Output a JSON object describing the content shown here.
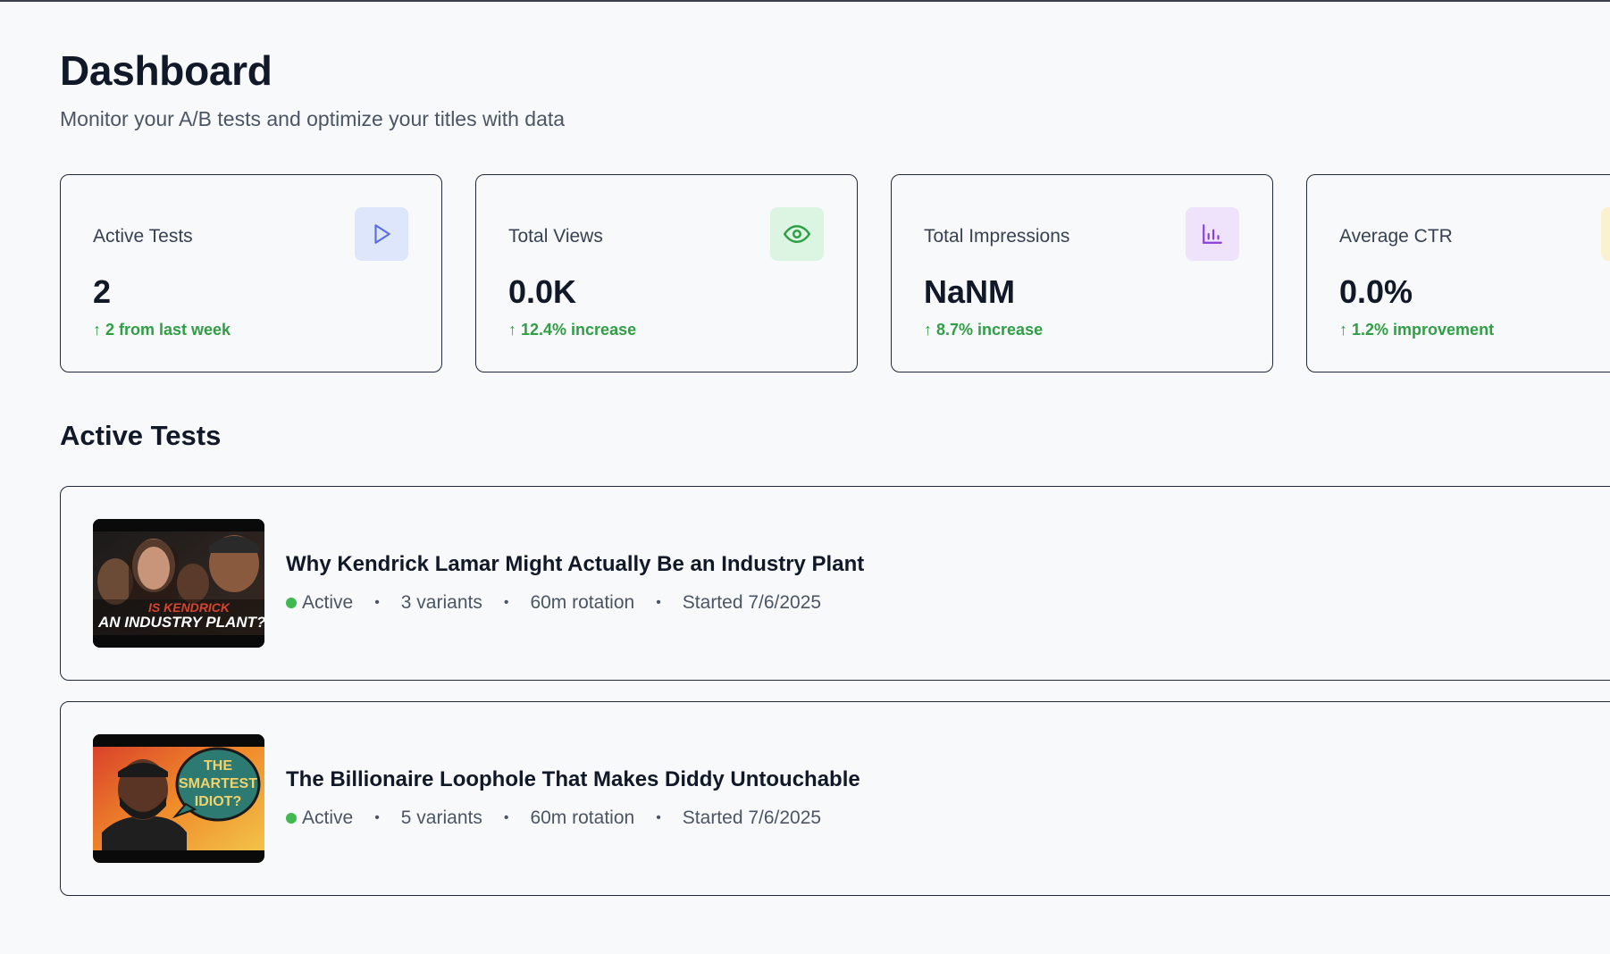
{
  "header": {
    "title": "Dashboard",
    "subtitle": "Monitor your A/B tests and optimize your titles with data"
  },
  "stats": [
    {
      "label": "Active Tests",
      "value": "2",
      "change": "↑ 2 from last week",
      "icon": "play-icon",
      "icon_bg": "#dde6fb",
      "icon_color": "#5b6ee1"
    },
    {
      "label": "Total Views",
      "value": "0.0K",
      "change": "↑ 12.4% increase",
      "icon": "eye-icon",
      "icon_bg": "#dcf5e3",
      "icon_color": "#2f9e44"
    },
    {
      "label": "Total Impressions",
      "value": "NaNM",
      "change": "↑ 8.7% increase",
      "icon": "bar-chart-icon",
      "icon_bg": "#efe3fb",
      "icon_color": "#8b3fd9"
    },
    {
      "label": "Average CTR",
      "value": "0.0%",
      "change": "↑ 1.2% improvement",
      "icon": "ctr-icon",
      "icon_bg": "#fbf0cf",
      "icon_color": "#d4a017"
    }
  ],
  "active_tests": {
    "section_title": "Active Tests",
    "items": [
      {
        "title": "Why Kendrick Lamar Might Actually Be an Industry Plant",
        "status": "Active",
        "variants": "3 variants",
        "rotation": "60m rotation",
        "started": "Started 7/6/2025",
        "thumbnail_text_1": "IS KENDRICK",
        "thumbnail_text_2": "AN INDUSTRY PLANT?"
      },
      {
        "title": "The Billionaire Loophole That Makes Diddy Untouchable",
        "status": "Active",
        "variants": "5 variants",
        "rotation": "60m rotation",
        "started": "Started 7/6/2025",
        "thumbnail_text_1": "THE",
        "thumbnail_text_2": "SMARTEST",
        "thumbnail_text_3": "IDIOT?"
      }
    ]
  },
  "colors": {
    "accent_green": "#2f9e44",
    "status_active": "#3fb950",
    "border": "#1f2937"
  }
}
